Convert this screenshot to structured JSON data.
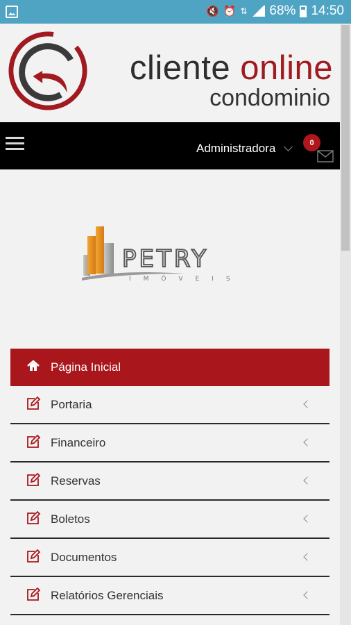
{
  "status_bar": {
    "battery": "68%",
    "time": "14:50",
    "icons": [
      "gallery-icon",
      "mute-icon",
      "alarm-icon",
      "data-icon",
      "signal-icon",
      "battery-icon"
    ]
  },
  "header": {
    "brand_word1": "cliente",
    "brand_word2": "online",
    "brand_sub": "condominio",
    "brand_colors": {
      "dark": "#2e2e2e",
      "red": "#a01a1f"
    }
  },
  "navbar": {
    "menu_icon": "hamburger-icon",
    "user_label": "Administradora",
    "badge_count": "0",
    "message_icon": "envelope-icon"
  },
  "company_logo": {
    "name": "PETRY",
    "tagline": "IMÓVEIS"
  },
  "menu": {
    "items": [
      {
        "label": "Página Inicial",
        "icon": "home-icon",
        "active": true
      },
      {
        "label": "Portaria",
        "icon": "edit-icon"
      },
      {
        "label": "Financeiro",
        "icon": "edit-icon"
      },
      {
        "label": "Reservas",
        "icon": "edit-icon"
      },
      {
        "label": "Boletos",
        "icon": "edit-icon"
      },
      {
        "label": "Documentos",
        "icon": "edit-icon"
      },
      {
        "label": "Relatórios Gerenciais",
        "icon": "edit-icon"
      }
    ]
  },
  "colors": {
    "status_bar": "#4fa4c4",
    "accent": "#a9171c",
    "navbar": "#000000",
    "background": "#f2f2f2"
  }
}
